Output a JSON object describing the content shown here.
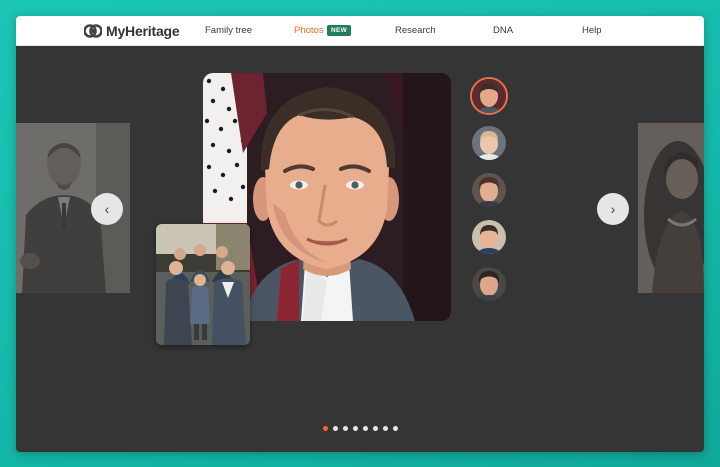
{
  "brand": {
    "name": "MyHeritage",
    "logo_icon": "myheritage-logo-icon"
  },
  "nav": {
    "items": [
      {
        "label": "Family tree"
      },
      {
        "label": "Photos",
        "active": true
      },
      {
        "label": "Research"
      },
      {
        "label": "DNA"
      },
      {
        "label": "Help"
      }
    ],
    "badge": "NEW",
    "active_color": "#f26a22",
    "badge_color": "#1f7e5c"
  },
  "carousel": {
    "prev_icon": "chevron-left-icon",
    "next_icon": "chevron-right-icon",
    "prev_glyph": "‹",
    "next_glyph": "›",
    "page_count": 8,
    "active_page": 1
  },
  "thumbnails": [
    {
      "icon": "face-thumbnail-1",
      "active": true
    },
    {
      "icon": "face-thumbnail-2"
    },
    {
      "icon": "face-thumbnail-3"
    },
    {
      "icon": "face-thumbnail-4"
    },
    {
      "icon": "face-thumbnail-5"
    }
  ],
  "colors": {
    "background": "#353535",
    "page": "#14b8a8",
    "accent": "#f26a22",
    "thumb_ring": "#e8714d"
  }
}
